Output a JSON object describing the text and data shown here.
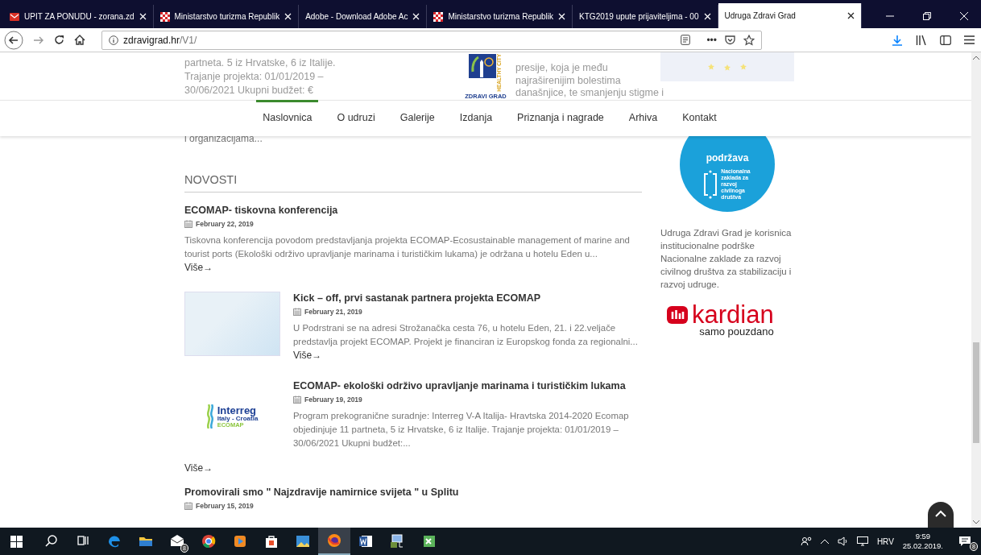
{
  "browser": {
    "tabs": [
      {
        "title": "UPIT ZA PONUDU - zorana.zd",
        "kind": "mail",
        "selected": false
      },
      {
        "title": "Ministarstvo turizma Republik",
        "kind": "crest",
        "selected": false
      },
      {
        "title": "Adobe - Download Adobe Ac",
        "kind": "plain",
        "selected": false
      },
      {
        "title": "Ministarstvo turizma Republik",
        "kind": "crest",
        "selected": false
      },
      {
        "title": "KTG2019 upute prijaviteljima - 00",
        "kind": "plain",
        "selected": false
      },
      {
        "title": "Udruga Zdravi Grad",
        "kind": "plain",
        "selected": true
      }
    ],
    "url_host": "zdravigrad.hr",
    "url_path": "/V1/",
    "more": "•••"
  },
  "site": {
    "logo": {
      "caption": "ZDRAVI GRAD",
      "vertical": "HEALTHY CITY"
    },
    "nav": [
      {
        "label": "Naslovnica",
        "selected": true
      },
      {
        "label": "O udruzi",
        "selected": false
      },
      {
        "label": "Galerije",
        "selected": false
      },
      {
        "label": "Izdanja",
        "selected": false
      },
      {
        "label": "Priznanja i nagrade",
        "selected": false
      },
      {
        "label": "Arhiva",
        "selected": false
      },
      {
        "label": "Kontakt",
        "selected": false
      }
    ],
    "faded_left": [
      "partneta. 5 iz Hrvatske, 6 iz Italije.",
      "Trajanje projekta: 01/01/2019 –",
      "30/06/2021 Ukupni budžet: €"
    ],
    "faded_right": [
      "presije, koja je među",
      "najraširenijim bolestima",
      "današnjice, te smanjenju stigme i"
    ],
    "intro_tail": "i organizacijama...",
    "section_title": "NOVOSTI",
    "posts": [
      {
        "kind": "plain",
        "title": "ECOMAP- tiskovna konferencija",
        "date": "February 22, 2019",
        "excerpt": "Tiskovna konferencija povodom predstavljanja projekta ECOMAP-Ecosustainable management of marine and tourist ports (Ekološki održivo upravljanje marinama i turističkim lukama) je održana u hotelu Eden u...",
        "more": "Više→"
      },
      {
        "kind": "photo",
        "title": "Kick – off, prvi sastanak partnera projekta ECOMAP",
        "date": "February 21, 2019",
        "excerpt": "U Podrstrani se na adresi Strožanačka cesta 76, u hotelu Eden, 21. i 22.veljače predstavlja projekt ECOMAP. Projekt je financiran iz Europskog fonda za regionalni...",
        "more": "Više→"
      },
      {
        "kind": "logo",
        "title": "ECOMAP- ekološki održivo upravljanje marinama i turističkim lukama",
        "date": "February 19, 2019",
        "excerpt": "Program prekogranične suradnje: Interreg V-A Italija- Hravtska 2014-2020 Ecomap objedinjuje 11 partneta, 5 iz Hrvatske, 6 iz Italije. Trajanje projekta: 01/01/2019 – 30/06/2021 Ukupni budžet:...",
        "more": "Više→",
        "logo": {
          "name": "Interreg",
          "region": "Italy - Croatia",
          "project": "ECOMAP"
        }
      },
      {
        "kind": "plain",
        "title": "Promovirali smo \" Najzdravije namirnice svijeta \" u Splitu",
        "date": "February 15, 2019"
      }
    ],
    "sidebar": {
      "badge": {
        "heading": "podržava",
        "lines": [
          "Nacionalna",
          "zaklada za",
          "razvoj",
          "civilnoga",
          "društva"
        ]
      },
      "text": "Udruga Zdravi Grad je korisnica institucionalne podrške Nacionalne zaklade za razvoj civilnog društva za stabilizaciju i razvoj udruge.",
      "sponsor": {
        "name": "kardian",
        "tagline": "samo pouzdano"
      }
    }
  },
  "taskbar": {
    "apps": [
      {
        "kind": "search",
        "active": false
      },
      {
        "kind": "taskview",
        "active": false
      },
      {
        "kind": "edge",
        "active": false
      },
      {
        "kind": "folder",
        "active": false
      },
      {
        "kind": "mail",
        "active": false,
        "badge": "8"
      },
      {
        "kind": "chrome",
        "active": false
      },
      {
        "kind": "player",
        "active": false
      },
      {
        "kind": "store",
        "active": false
      },
      {
        "kind": "photos",
        "active": false
      },
      {
        "kind": "firefox",
        "active": true
      },
      {
        "kind": "word",
        "active": false
      },
      {
        "kind": "network",
        "active": false
      },
      {
        "kind": "excel",
        "active": false
      }
    ],
    "lang": "HRV",
    "time": "9:59",
    "date": "25.02.2019.",
    "notifications": "8"
  }
}
